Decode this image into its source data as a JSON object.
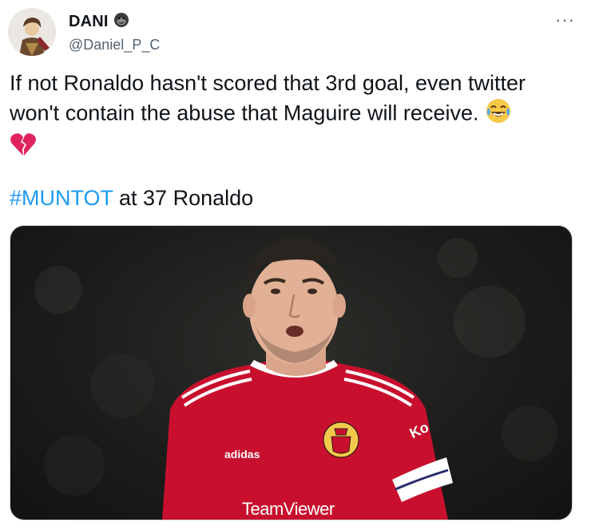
{
  "user": {
    "name": "DANI",
    "handle": "@Daniel_P_C",
    "badge_icon": "gorilla-emoji-icon",
    "avatar_icon": "cartoon-avatar-icon"
  },
  "tweet": {
    "text_line1": "If not Ronaldo hasn't scored that 3rd goal, even twitter",
    "text_line2": "won't contain the abuse that Maguire will receive.",
    "emoji1": "laughing-tears-emoji-icon",
    "emoji2": "broken-heart-emoji-icon",
    "hashtag": "#MUNTOT",
    "after_hashtag": " at 37 Ronaldo"
  },
  "media": {
    "jersey_sponsor": "TeamViewer",
    "jersey_brand": "adidas",
    "armband": "Captain",
    "crest": "MANCHESTER UNITED",
    "sleeve_text": "Ko"
  },
  "colors": {
    "link": "#1d9bf0",
    "text": "#0f1419",
    "secondary": "#536471",
    "jersey_red": "#c8102e"
  }
}
